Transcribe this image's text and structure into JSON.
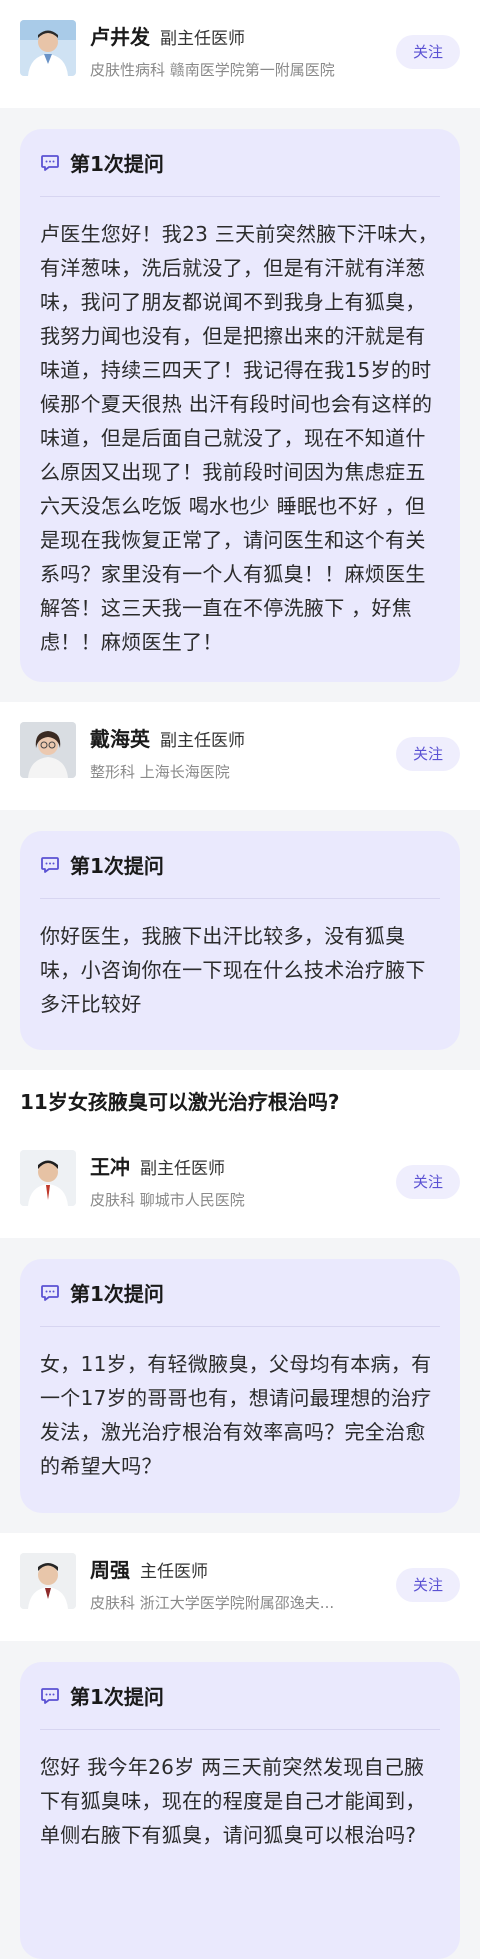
{
  "entries": [
    {
      "doctor": {
        "name": "卢井发",
        "title": "副主任医师",
        "department": "皮肤性病科",
        "hospital": "赣南医学院第一附属医院",
        "follow_label": "关注",
        "avatar": "doctor-avatar"
      },
      "question": {
        "label": "第1次提问",
        "text": "卢医生您好！我23 三天前突然腋下汗味大，有洋葱味，洗后就没了，但是有汗就有洋葱味，我问了朋友都说闻不到我身上有狐臭，我努力闻也没有，但是把擦出来的汗就是有味道，持续三四天了！我记得在我15岁的时候那个夏天很热 出汗有段时间也会有这样的味道，但是后面自己就没了，现在不知道什么原因又出现了！我前段时间因为焦虑症五六天没怎么吃饭  喝水也少 睡眠也不好 ，但是现在我恢复正常了，请问医生和这个有关系吗？家里没有一个人有狐臭！！麻烦医生解答！这三天我一直在不停洗腋下 ，好焦虑！！麻烦医生了！"
      }
    },
    {
      "doctor": {
        "name": "戴海英",
        "title": "副主任医师",
        "department": "整形科",
        "hospital": "上海长海医院",
        "follow_label": "关注",
        "avatar": "doctor-avatar"
      },
      "question": {
        "label": "第1次提问",
        "text": "你好医生，我腋下出汗比较多，没有狐臭味，小咨询你在一下现在什么技术治疗腋下多汗比较好"
      }
    },
    {
      "topic": "11岁女孩腋臭可以激光治疗根治吗?",
      "doctor": {
        "name": "王冲",
        "title": "副主任医师",
        "department": "皮肤科",
        "hospital": "聊城市人民医院",
        "follow_label": "关注",
        "avatar": "doctor-avatar"
      },
      "question": {
        "label": "第1次提问",
        "text": "女，11岁，有轻微腋臭，父母均有本病，有一个17岁的哥哥也有，想请问最理想的治疗发法，激光治疗根治有效率高吗？完全治愈的希望大吗？"
      }
    },
    {
      "doctor": {
        "name": "周强",
        "title": "主任医师",
        "department": "皮肤科",
        "hospital": "浙江大学医学院附属邵逸夫...",
        "follow_label": "关注",
        "avatar": "doctor-avatar"
      },
      "question": {
        "label": "第1次提问",
        "text": "您好  我今年26岁  两三天前突然发现自己腋下有狐臭味，现在的程度是自己才能闻到，单侧右腋下有狐臭，请问狐臭可以根治吗?"
      }
    }
  ],
  "colors": {
    "accent": "#5b52d3",
    "follow_bg": "#efeefd",
    "card_bg": "#eae9fd",
    "page_bg": "#f4f5f7"
  }
}
